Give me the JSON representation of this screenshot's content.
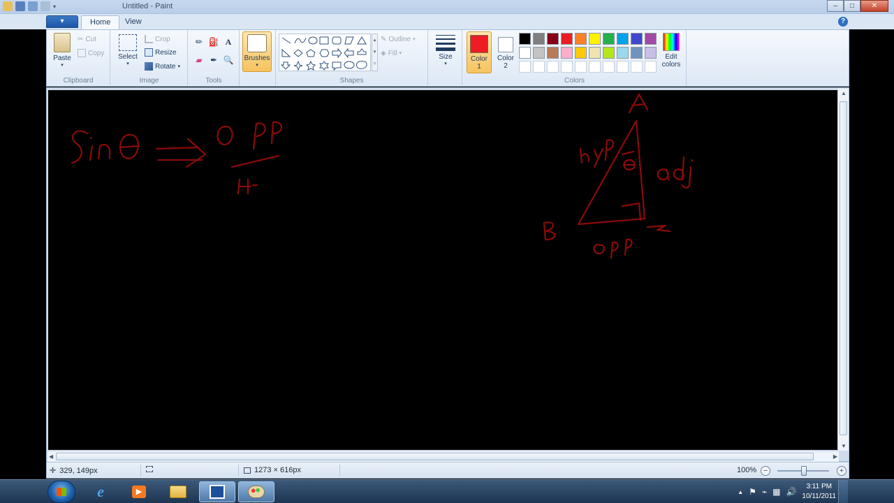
{
  "window": {
    "title": "Untitled - Paint",
    "buttons": {
      "minimize": "–",
      "maximize": "□",
      "close": "✕"
    }
  },
  "menu": {
    "app_button": "▾",
    "tabs": [
      "Home",
      "View"
    ],
    "help": "?"
  },
  "ribbon": {
    "clipboard": {
      "label": "Clipboard",
      "paste": "Paste",
      "cut": "Cut",
      "copy": "Copy"
    },
    "image": {
      "label": "Image",
      "select": "Select",
      "crop": "Crop",
      "resize": "Resize",
      "rotate": "Rotate"
    },
    "tools": {
      "label": "Tools"
    },
    "brushes": {
      "label": "Brushes"
    },
    "shapes": {
      "label": "Shapes",
      "outline": "Outline",
      "fill": "Fill"
    },
    "size": {
      "label": "Size"
    },
    "colors": {
      "label": "Colors",
      "color1": {
        "label": "Color",
        "num": "1",
        "value": "#ee1c24"
      },
      "color2": {
        "label": "Color",
        "num": "2",
        "value": "#ffffff"
      },
      "edit": {
        "line1": "Edit",
        "line2": "colors"
      },
      "palette_row1": [
        "#000000",
        "#7f7f7f",
        "#880015",
        "#ed1c24",
        "#ff7f27",
        "#fff200",
        "#22b14c",
        "#00a2e8",
        "#3f48cc",
        "#a349a4"
      ],
      "palette_row2": [
        "#ffffff",
        "#c3c3c3",
        "#b97a57",
        "#ffaec9",
        "#ffc90e",
        "#efe4b0",
        "#b5e61d",
        "#99d9ea",
        "#7092be",
        "#c8bfe7"
      ]
    }
  },
  "status": {
    "cursor_pos": "329, 149px",
    "canvas_size": "1273 × 616px",
    "zoom": "100%",
    "zoom_minus": "−",
    "zoom_plus": "+"
  },
  "taskbar": {
    "time": "3:11 PM",
    "date": "10/11/2011"
  },
  "drawing": {
    "ink_color": "#8b0a0a"
  }
}
